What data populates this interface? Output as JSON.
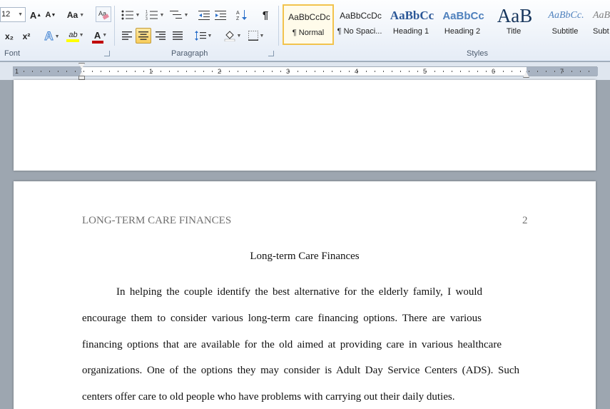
{
  "font_group": {
    "font_size_value": "12",
    "label": "Font",
    "grow_font": "A",
    "shrink_font": "A",
    "change_case": "Aa",
    "subscript": "x₂",
    "superscript": "x²",
    "text_effects": "A",
    "highlight": "ab",
    "font_color": "A",
    "font_color_hex": "#c00000",
    "highlight_hex": "#ffff00"
  },
  "paragraph_group": {
    "label": "Paragraph",
    "show_marks": "¶"
  },
  "styles_group": {
    "label": "Styles",
    "items": [
      {
        "preview": "AaBbCcDc",
        "name": "¶ Normal",
        "active": true
      },
      {
        "preview": "AaBbCcDc",
        "name": "¶ No Spaci..."
      },
      {
        "preview": "AaBbCc",
        "name": "Heading 1"
      },
      {
        "preview": "AaBbCc",
        "name": "Heading 2"
      },
      {
        "preview": "AaB",
        "name": "Title"
      },
      {
        "preview": "AaBbCc.",
        "name": "Subtitle"
      },
      {
        "preview": "AaB",
        "name": "Subt"
      }
    ]
  },
  "ruler": {
    "numbers": [
      "1",
      "1",
      "2",
      "3",
      "4",
      "5",
      "6",
      "7"
    ]
  },
  "document": {
    "running_head": "LONG-TERM CARE FINANCES",
    "page_number": "2",
    "title": "Long-term Care Finances",
    "lines": [
      "In helping the couple identify the best alternative for the elderly family, I would",
      "encourage them to consider various long-term care financing options. There are various",
      "financing options that are available for the old aimed at providing care in various healthcare",
      "organizations. One of the options they may consider is Adult Day Service Centers (ADS). Such",
      "centers offer care to old people who have problems with carrying out their daily duties."
    ]
  }
}
